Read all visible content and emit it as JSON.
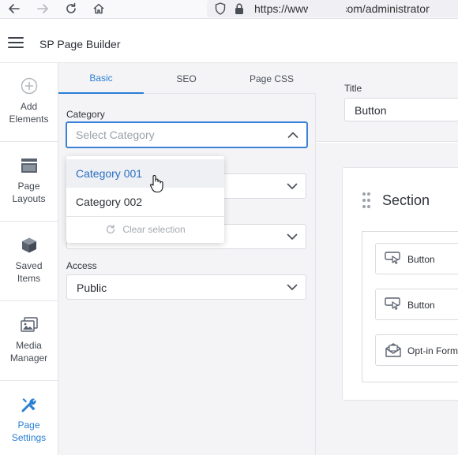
{
  "browser": {
    "url": "https://www.bo         m.com/administrator"
  },
  "header": {
    "title": "SP Page Builder"
  },
  "sidebar": {
    "items": [
      {
        "label": "Add Elements",
        "icon": "plus-circle-icon",
        "active": false
      },
      {
        "label": "Page Layouts",
        "icon": "layout-icon",
        "active": false
      },
      {
        "label": "Saved Items",
        "icon": "box-icon",
        "active": false
      },
      {
        "label": "Media Manager",
        "icon": "images-icon",
        "active": false
      },
      {
        "label": "Page Settings",
        "icon": "tools-icon",
        "active": true
      }
    ]
  },
  "panel": {
    "tabs": [
      {
        "label": "Basic",
        "active": true
      },
      {
        "label": "SEO",
        "active": false
      },
      {
        "label": "Page CSS",
        "active": false
      }
    ],
    "category": {
      "label": "Category",
      "placeholder": "Select Category"
    },
    "dropdown": {
      "options": [
        "Category 001",
        "Category 002"
      ],
      "hovered": "Category 001",
      "clear_label": "Clear selection"
    },
    "access": {
      "label": "Access",
      "value": "Public"
    }
  },
  "canvas": {
    "title_label": "Title",
    "title_value": "Button",
    "section_title": "Section",
    "addons": [
      {
        "label": "Button",
        "icon": "button-cursor-icon"
      },
      {
        "label": "Button",
        "icon": "button-cursor-icon"
      },
      {
        "label": "Opt-in Form",
        "icon": "envelope-icon"
      }
    ]
  },
  "colors": {
    "accent": "#2a7fd4",
    "panel_bg": "#f4f4f6",
    "focus_border": "#3b82d6"
  }
}
